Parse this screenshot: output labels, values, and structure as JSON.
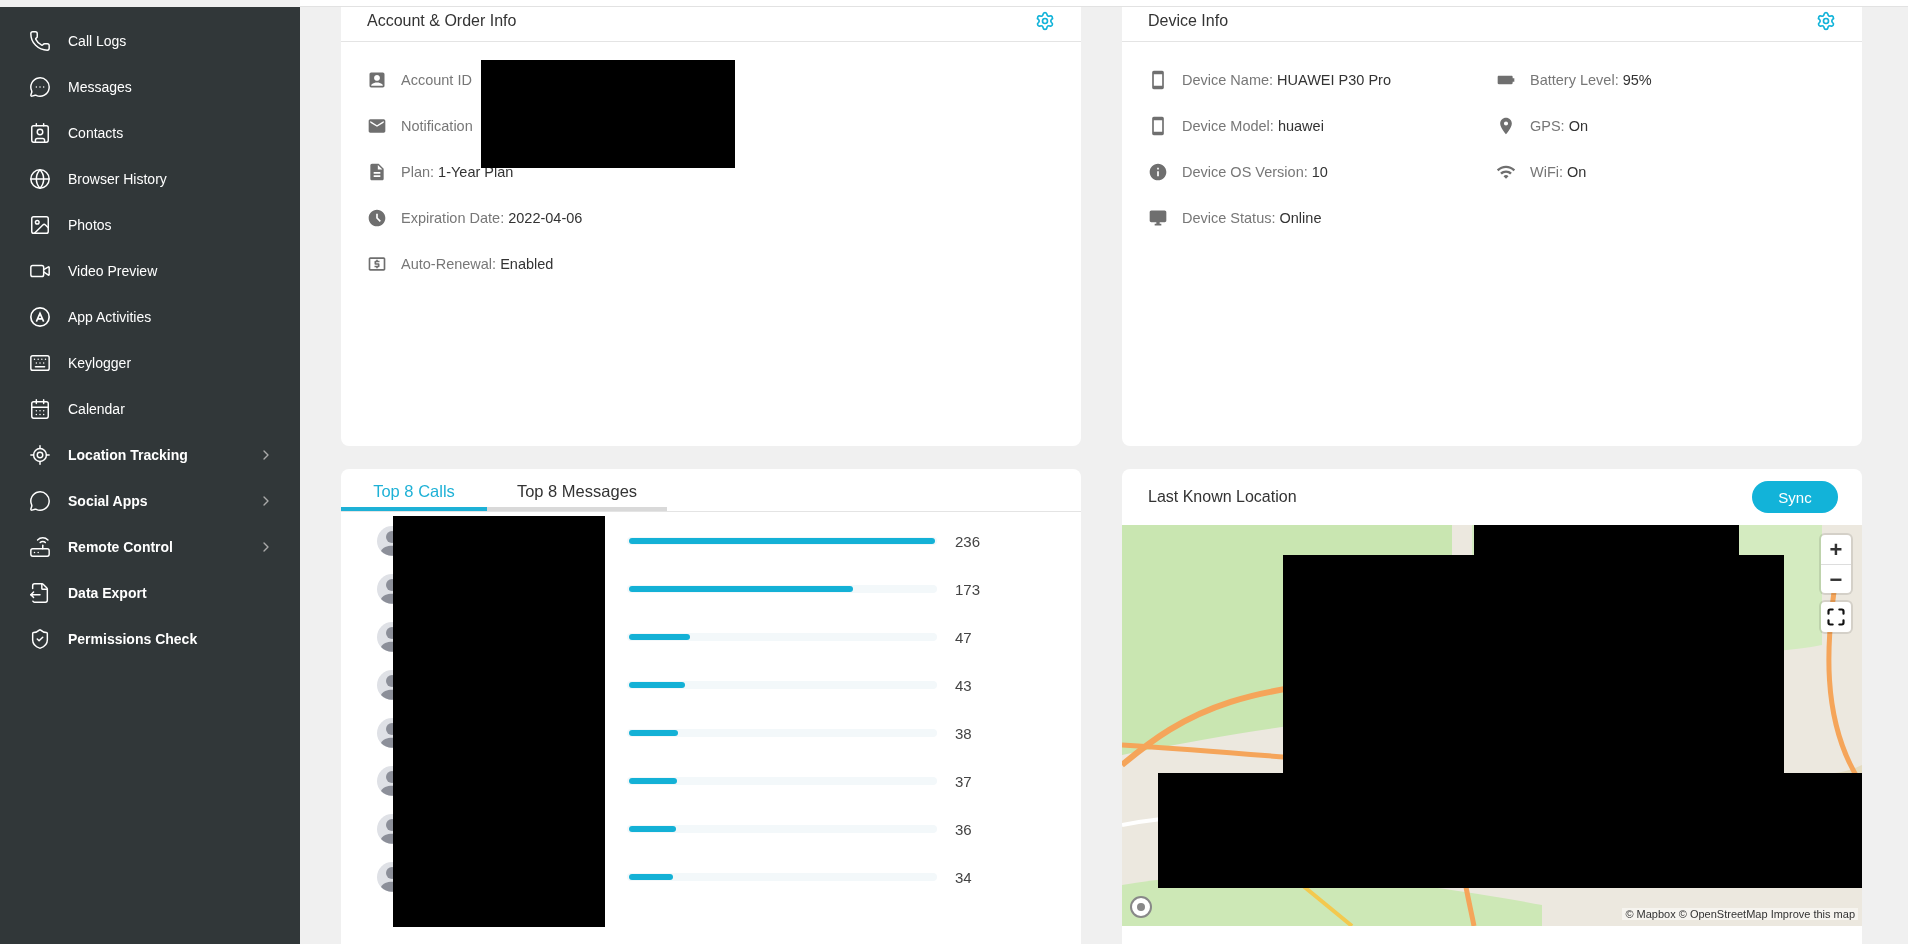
{
  "sidebar": {
    "items": [
      {
        "label": "Call Logs",
        "kind": "page"
      },
      {
        "label": "Messages",
        "kind": "page"
      },
      {
        "label": "Contacts",
        "kind": "page"
      },
      {
        "label": "Browser History",
        "kind": "page"
      },
      {
        "label": "Photos",
        "kind": "page"
      },
      {
        "label": "Video Preview",
        "kind": "page"
      },
      {
        "label": "App Activities",
        "kind": "page"
      },
      {
        "label": "Keylogger",
        "kind": "page"
      },
      {
        "label": "Calendar",
        "kind": "page"
      },
      {
        "label": "Location Tracking",
        "kind": "group"
      },
      {
        "label": "Social Apps",
        "kind": "group"
      },
      {
        "label": "Remote Control",
        "kind": "group"
      },
      {
        "label": "Data Export",
        "kind": "tool"
      },
      {
        "label": "Permissions Check",
        "kind": "tool"
      }
    ]
  },
  "account_card": {
    "title": "Account & Order Info",
    "redacted": true,
    "rows": [
      {
        "label": "Account ID"
      },
      {
        "label": "Notification"
      },
      {
        "label": "Plan:",
        "value": "1-Year Plan"
      },
      {
        "label": "Expiration Date:",
        "value": "2022-04-06"
      },
      {
        "label": "Auto-Renewal:",
        "value": "Enabled"
      }
    ]
  },
  "device_card": {
    "title": "Device Info",
    "columns": [
      [
        {
          "label": "Device Name:",
          "value": "HUAWEI P30 Pro"
        },
        {
          "label": "Device Model:",
          "value": "huawei"
        },
        {
          "label": "Device OS Version:",
          "value": "10"
        },
        {
          "label": "Device Status:",
          "value": "Online"
        }
      ],
      [
        {
          "label": "Battery Level:",
          "value": "95%"
        },
        {
          "label": "GPS:",
          "value": "On"
        },
        {
          "label": "WiFi:",
          "value": "On"
        }
      ]
    ]
  },
  "top_card": {
    "redacted": true,
    "tabs": [
      {
        "label": "Top 8 Calls",
        "selected": true
      },
      {
        "label": "Top 8 Messages",
        "selected": false
      }
    ],
    "rows": [
      {
        "count": "236",
        "level": 1
      },
      {
        "count": "173",
        "level": 0.733
      },
      {
        "count": "47",
        "level": 0.199
      },
      {
        "count": "43",
        "level": 0.182
      },
      {
        "count": "38",
        "level": 0.161
      },
      {
        "count": "37",
        "level": 0.157
      },
      {
        "count": "36",
        "level": 0.153
      },
      {
        "count": "34",
        "level": 0.144
      }
    ]
  },
  "location_card": {
    "title": "Last Known Location",
    "sync_button": "Sync",
    "map": {
      "kind": "picture",
      "redacted": true,
      "zoom_in": "+",
      "zoom_out": "−",
      "attribution": "© Mapbox © OpenStreetMap Improve this map"
    }
  }
}
